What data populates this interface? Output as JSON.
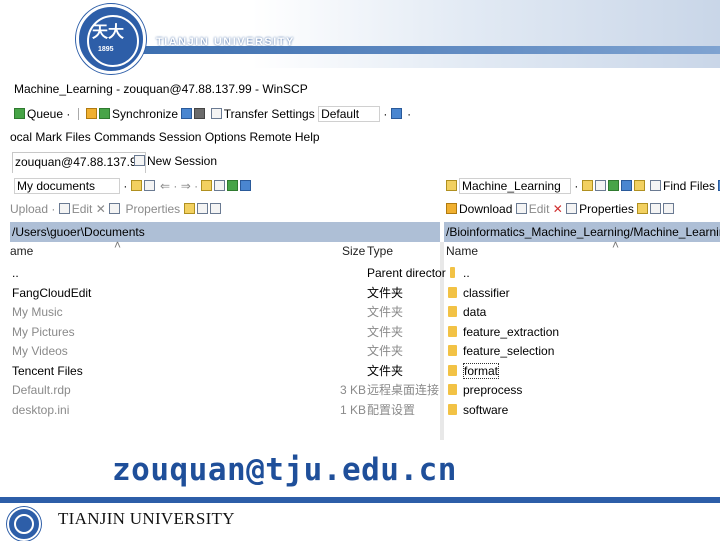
{
  "slide": {
    "university": "TIANJIN UNIVERSITY",
    "university_footer": "TIANJIN UNIVERSITY",
    "seal_text": "天大",
    "seal_year": "1895",
    "email": "zouquan@tju.edu.cn",
    "accent_color": "#2d5ea8",
    "email_color": "#1f4f9a"
  },
  "window": {
    "title": "Machine_Learning - zouquan@47.88.137.99 - WinSCP"
  },
  "toolbar": {
    "queue": "Queue",
    "synchronize": "Synchronize",
    "transfer_settings": "Transfer Settings",
    "transfer_value": "Default"
  },
  "menu": {
    "local": "ocal",
    "mark": "Mark",
    "files": "Files",
    "commands": "Commands",
    "session": "Session",
    "options": "Options",
    "remote": "Remote",
    "help": "Help"
  },
  "session_tabs": {
    "active": "zouquan@47.88.137.99",
    "new": "New Session"
  },
  "left_panel": {
    "drive": "My documents",
    "upload": "Upload",
    "edit": "Edit",
    "properties": "Properties",
    "path": "/Users\\guoer\\Documents",
    "col_name": "ame",
    "col_size": "Size",
    "col_type": "Type",
    "items": [
      {
        "name": "..",
        "size": "",
        "type": "Parent director",
        "grey": false
      },
      {
        "name": "FangCloudEdit",
        "size": "",
        "type": "文件夹",
        "grey": false
      },
      {
        "name": "My Music",
        "size": "",
        "type": "文件夹",
        "grey": true
      },
      {
        "name": "My Pictures",
        "size": "",
        "type": "文件夹",
        "grey": true
      },
      {
        "name": "My Videos",
        "size": "",
        "type": "文件夹",
        "grey": true
      },
      {
        "name": "Tencent Files",
        "size": "",
        "type": "文件夹",
        "grey": false
      },
      {
        "name": "Default.rdp",
        "size": "3 KB",
        "type": "远程桌面连接",
        "grey": true
      },
      {
        "name": "desktop.ini",
        "size": "1 KB",
        "type": "配置设置",
        "grey": true
      }
    ]
  },
  "right_panel": {
    "drive": "Machine_Learning",
    "find_files": "Find Files",
    "download": "Download",
    "edit": "Edit",
    "properties": "Properties",
    "path": "/Bioinformatics_Machine_Learning/Machine_Learning",
    "col_name": "Name",
    "items": [
      {
        "name": "..",
        "up": true
      },
      {
        "name": "classifier",
        "up": false
      },
      {
        "name": "data",
        "up": false
      },
      {
        "name": "feature_extraction",
        "up": false
      },
      {
        "name": "feature_selection",
        "up": false
      },
      {
        "name": "format",
        "up": false
      },
      {
        "name": "preprocess",
        "up": false
      },
      {
        "name": "software",
        "up": false
      }
    ]
  }
}
